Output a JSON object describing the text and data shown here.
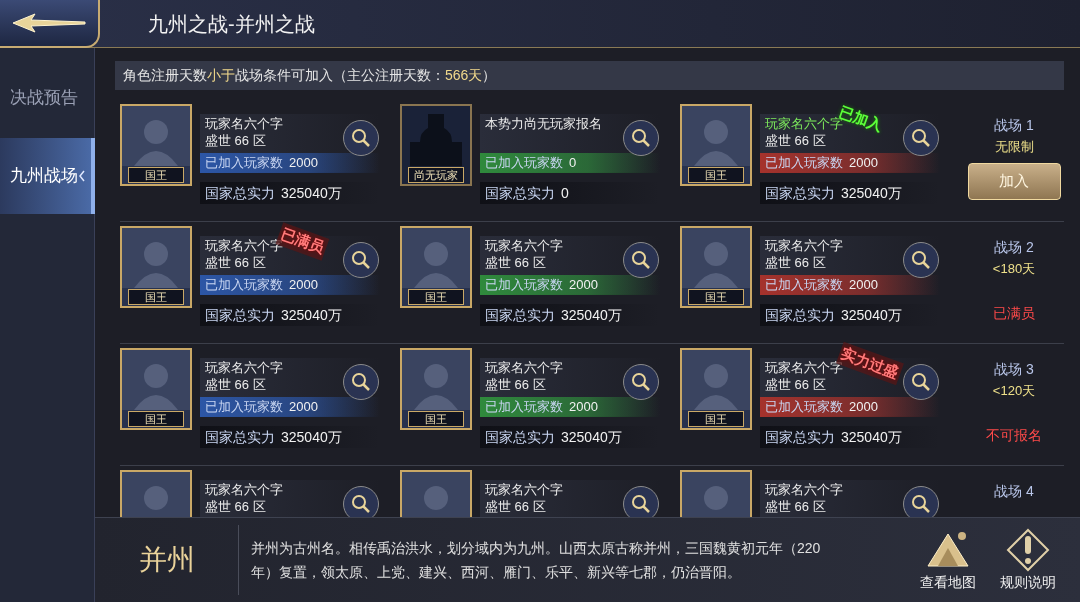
{
  "header": {
    "title": "九州之战-并州之战"
  },
  "sidebar": {
    "items": [
      {
        "label": "决战预告",
        "selected": false
      },
      {
        "label": "九州战场",
        "selected": true
      }
    ]
  },
  "notice": [
    {
      "text": "角色注册天数",
      "highlight": false
    },
    {
      "text": "小于",
      "highlight": true
    },
    {
      "text": "战场条件可加入（主公注册天数：",
      "highlight": false
    },
    {
      "text": "566天",
      "highlight": true
    },
    {
      "text": "）",
      "highlight": false
    }
  ],
  "battlefields": [
    {
      "label": "战场 1",
      "condition": "无限制",
      "action": {
        "kind": "button",
        "text": "加入"
      },
      "cards": [
        {
          "kind": "player",
          "rank": "国王",
          "name": "玩家名六个字",
          "name_highlighted": false,
          "server": "盛世 66 区",
          "joined_label": "已加入玩家数",
          "joined": "2000",
          "power_label": "国家总实力",
          "power": "325040万",
          "color": "#2c56a6"
        },
        {
          "kind": "empty",
          "rank": "尚无玩家",
          "name": "本势力尚无玩家报名",
          "name_highlighted": false,
          "joined_label": "已加入玩家数",
          "joined": "0",
          "power_label": "国家总实力",
          "power": "0",
          "color": "#2f8a3c"
        },
        {
          "kind": "player",
          "rank": "国王",
          "name": "玩家名六个字",
          "name_highlighted": true,
          "server": "盛世 66 区",
          "joined_label": "已加入玩家数",
          "joined": "2000",
          "power_label": "国家总实力",
          "power": "325040万",
          "color": "#a5322c",
          "tag": {
            "text": "已加入",
            "kind": "joined"
          }
        }
      ]
    },
    {
      "label": "战场 2",
      "condition": "<180天",
      "action": {
        "kind": "status",
        "text": "已满员"
      },
      "cards": [
        {
          "kind": "player",
          "rank": "国王",
          "name": "玩家名六个字",
          "name_highlighted": false,
          "server": "盛世 66 区",
          "joined_label": "已加入玩家数",
          "joined": "2000",
          "power_label": "国家总实力",
          "power": "325040万",
          "color": "#2c56a6",
          "tag": {
            "text": "已满员",
            "kind": "warning"
          }
        },
        {
          "kind": "player",
          "rank": "国王",
          "name": "玩家名六个字",
          "name_highlighted": false,
          "server": "盛世 66 区",
          "joined_label": "已加入玩家数",
          "joined": "2000",
          "power_label": "国家总实力",
          "power": "325040万",
          "color": "#2f8a3c"
        },
        {
          "kind": "player",
          "rank": "国王",
          "name": "玩家名六个字",
          "name_highlighted": false,
          "server": "盛世 66 区",
          "joined_label": "已加入玩家数",
          "joined": "2000",
          "power_label": "国家总实力",
          "power": "325040万",
          "color": "#a5322c"
        }
      ]
    },
    {
      "label": "战场 3",
      "condition": "<120天",
      "action": {
        "kind": "status",
        "text": "不可报名"
      },
      "cards": [
        {
          "kind": "player",
          "rank": "国王",
          "name": "玩家名六个字",
          "name_highlighted": false,
          "server": "盛世 66 区",
          "joined_label": "已加入玩家数",
          "joined": "2000",
          "power_label": "国家总实力",
          "power": "325040万",
          "color": "#2c56a6"
        },
        {
          "kind": "player",
          "rank": "国王",
          "name": "玩家名六个字",
          "name_highlighted": false,
          "server": "盛世 66 区",
          "joined_label": "已加入玩家数",
          "joined": "2000",
          "power_label": "国家总实力",
          "power": "325040万",
          "color": "#2f8a3c"
        },
        {
          "kind": "player",
          "rank": "国王",
          "name": "玩家名六个字",
          "name_highlighted": false,
          "server": "盛世 66 区",
          "joined_label": "已加入玩家数",
          "joined": "2000",
          "power_label": "国家总实力",
          "power": "325040万",
          "color": "#a5322c",
          "tag": {
            "text": "实力过盛",
            "kind": "warning"
          }
        }
      ]
    },
    {
      "label": "战场 4",
      "cards": [
        {
          "kind": "player",
          "name": "玩家名六个字",
          "name_highlighted": false,
          "server": "盛世 66 区"
        },
        {
          "kind": "player",
          "name": "玩家名六个字",
          "name_highlighted": false,
          "server": "盛世 66 区"
        },
        {
          "kind": "player",
          "name": "玩家名六个字",
          "name_highlighted": false,
          "server": "盛世 66 区"
        }
      ]
    }
  ],
  "region": {
    "name": "并州",
    "description": "并州为古州名。相传禹治洪水，划分域内为九州。山西太原古称并州，三国魏黄初元年（220年）复置，领太原、上党、建兴、西河、雁门、乐平、新兴等七郡，仍治晋阳。",
    "buttons": [
      {
        "kind": "map",
        "label": "查看地图"
      },
      {
        "kind": "rules",
        "label": "规则说明"
      }
    ]
  }
}
